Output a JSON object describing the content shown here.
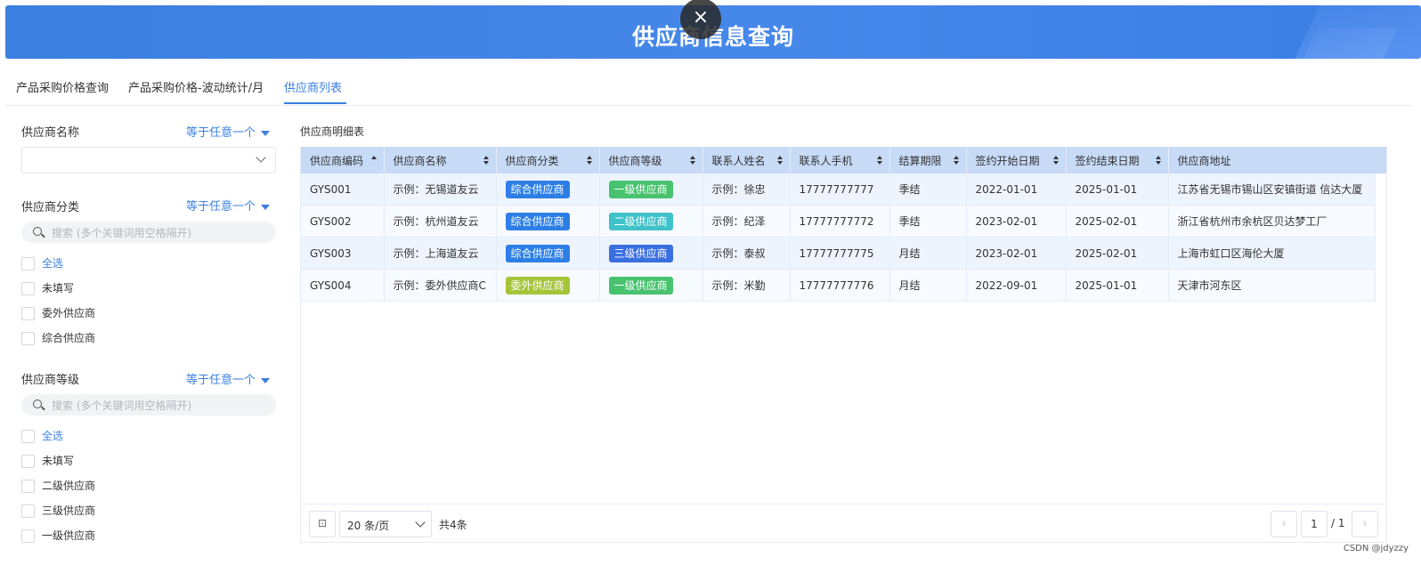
{
  "banner": {
    "title": "供应商信息查询",
    "close_icon": "×"
  },
  "tabs": [
    {
      "label": "产品采购价格查询"
    },
    {
      "label": "产品采购价格-波动统计/月"
    },
    {
      "label": "供应商列表"
    }
  ],
  "filters": {
    "supplier_name": {
      "title": "供应商名称",
      "mode": "等于任意一个"
    },
    "supplier_category": {
      "title": "供应商分类",
      "mode": "等于任意一个",
      "search_placeholder": "搜索 (多个关键词用空格隔开)",
      "options": [
        "全选",
        "未填写",
        "委外供应商",
        "综合供应商"
      ]
    },
    "supplier_level": {
      "title": "供应商等级",
      "mode": "等于任意一个",
      "search_placeholder": "搜索 (多个关键词用空格隔开)",
      "options": [
        "全选",
        "未填写",
        "二级供应商",
        "三级供应商",
        "一级供应商"
      ]
    }
  },
  "table": {
    "title": "供应商明细表",
    "columns": [
      "供应商编码",
      "供应商名称",
      "供应商分类",
      "供应商等级",
      "联系人姓名",
      "联系人手机",
      "结算期限",
      "签约开始日期",
      "签约结束日期",
      "供应商地址"
    ],
    "rows": [
      {
        "code": "GYS001",
        "name": "示例：无锡道友云",
        "category": "综合供应商",
        "level": "一级供应商",
        "contact": "示例：徐忠",
        "phone": "17777777777",
        "term": "季结",
        "start": "2022-01-01",
        "end": "2025-01-01",
        "address": "江苏省无锡市锡山区安镇街道 信达大厦"
      },
      {
        "code": "GYS002",
        "name": "示例：杭州道友云",
        "category": "综合供应商",
        "level": "二级供应商",
        "contact": "示例：纪泽",
        "phone": "17777777772",
        "term": "季结",
        "start": "2023-02-01",
        "end": "2025-02-01",
        "address": "浙江省杭州市余杭区贝达梦工厂"
      },
      {
        "code": "GYS003",
        "name": "示例：上海道友云",
        "category": "综合供应商",
        "level": "三级供应商",
        "contact": "示例：泰叔",
        "phone": "17777777775",
        "term": "月结",
        "start": "2023-02-01",
        "end": "2025-02-01",
        "address": "上海市虹口区海伦大厦"
      },
      {
        "code": "GYS004",
        "name": "示例：委外供应商C",
        "category": "委外供应商",
        "level": "一级供应商",
        "contact": "示例：米勤",
        "phone": "17777777776",
        "term": "月结",
        "start": "2022-09-01",
        "end": "2025-01-01",
        "address": "天津市河东区"
      }
    ],
    "tag_colors": {
      "综合供应商": "#2d7fe6",
      "委外供应商": "#a6c43a",
      "一级供应商": "#47c26e",
      "二级供应商": "#3fc2c9",
      "三级供应商": "#3a6fe0"
    }
  },
  "pager": {
    "page_size": "20 条/页",
    "total": "共4条",
    "current_page": "1",
    "total_pages": "/ 1",
    "prev_icon": "‹",
    "next_icon": "›",
    "settings_icon": "⊡"
  },
  "watermark": "CSDN @jdyzzy",
  "colors": {
    "accent": "#3b7fe0",
    "header_bg": "#c7dbf7"
  }
}
